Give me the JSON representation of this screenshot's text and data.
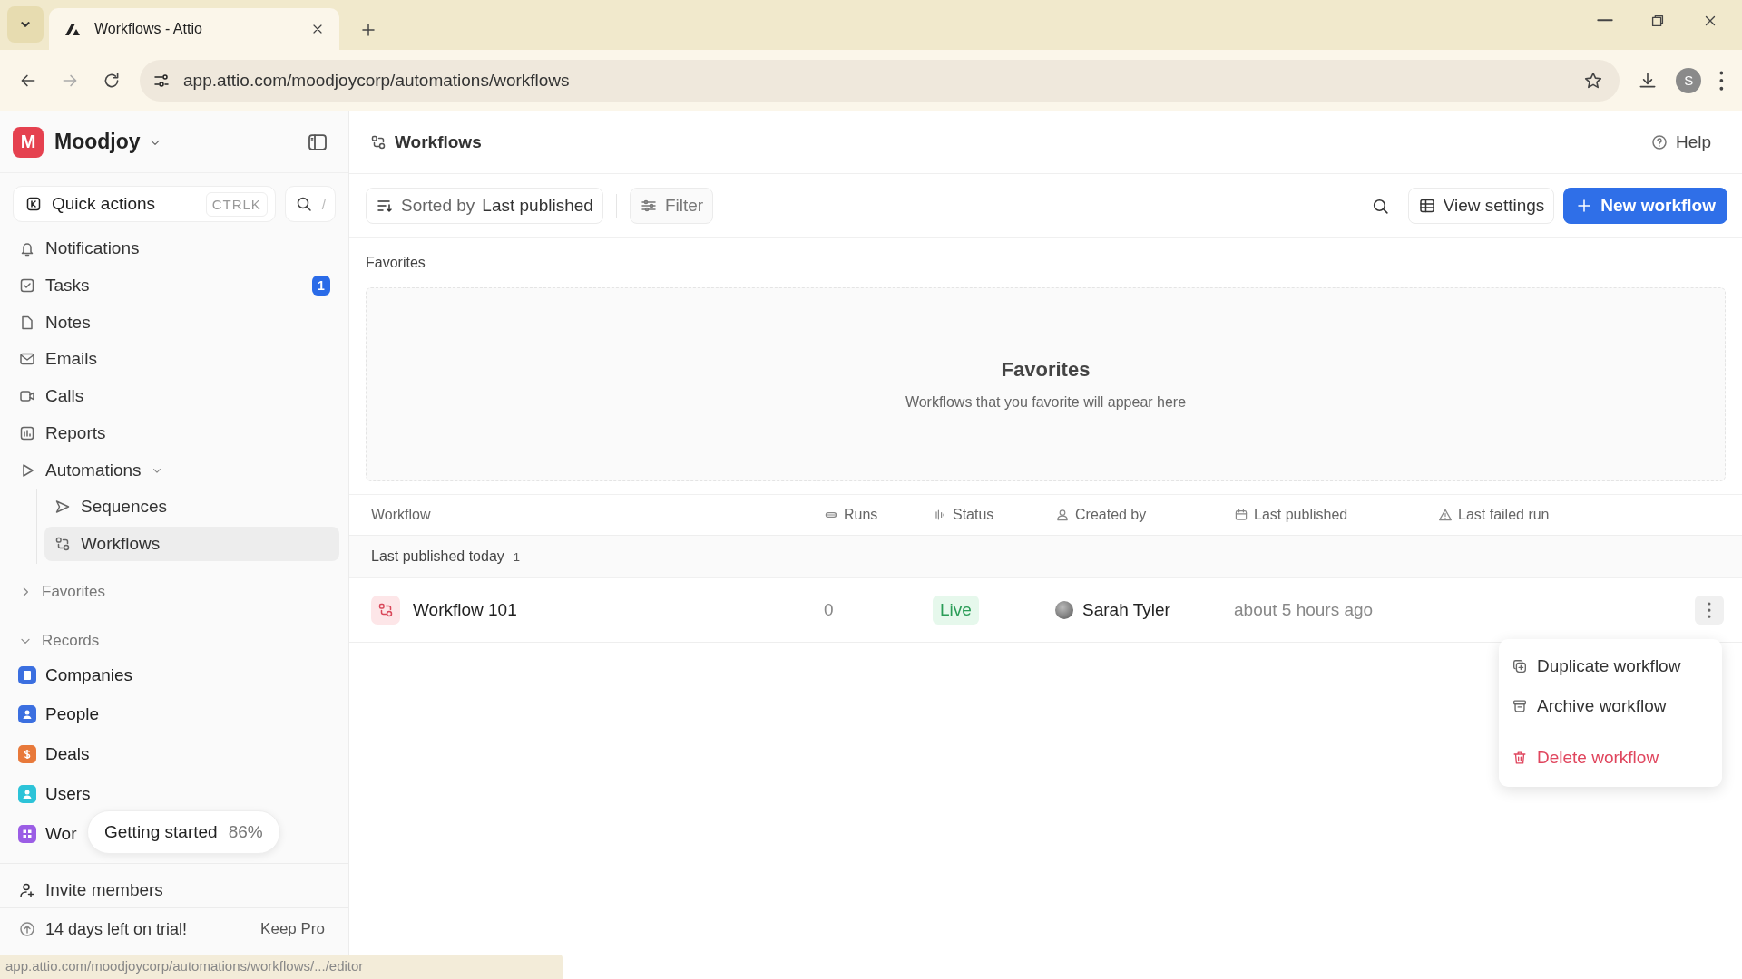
{
  "browser": {
    "tab_title": "Workflows - Attio",
    "url": "app.attio.com/moodjoycorp/automations/workflows",
    "profile_initial": "S",
    "status_url": "app.attio.com/moodjoycorp/automations/workflows/.../editor"
  },
  "sidebar": {
    "workspace": {
      "initial": "M",
      "name": "Moodjoy"
    },
    "quick_actions": {
      "label": "Quick actions",
      "shortcut": "CTRLK",
      "search_shortcut": "/"
    },
    "nav": [
      {
        "kind": "bell",
        "label": "Notifications",
        "selected": false
      },
      {
        "kind": "task",
        "label": "Tasks",
        "badge": "1",
        "selected": false
      },
      {
        "kind": "note",
        "label": "Notes",
        "selected": false
      },
      {
        "kind": "mail",
        "label": "Emails",
        "selected": false
      },
      {
        "kind": "call",
        "label": "Calls",
        "selected": false
      },
      {
        "kind": "report",
        "label": "Reports",
        "selected": false
      },
      {
        "kind": "automation",
        "label": "Automations",
        "selected": false,
        "expanded": true,
        "children": [
          {
            "kind": "sequence",
            "label": "Sequences",
            "selected": false
          },
          {
            "kind": "workflow",
            "label": "Workflows",
            "selected": true
          }
        ]
      }
    ],
    "favorites": {
      "label": "Favorites",
      "expanded": false
    },
    "records": {
      "label": "Records",
      "expanded": true,
      "items": [
        {
          "kind": "company",
          "label": "Companies",
          "color": "#3b6fe0"
        },
        {
          "kind": "person",
          "label": "People",
          "color": "#3b6fe0"
        },
        {
          "kind": "deal",
          "label": "Deals",
          "color": "#e8793a"
        },
        {
          "kind": "person",
          "label": "Users",
          "color": "#2cc3d8"
        },
        {
          "kind": "grid",
          "label": "Wor",
          "color": "#9b5de5"
        }
      ]
    },
    "getting_started": {
      "label": "Getting started",
      "percent": "86%"
    },
    "invite": "Invite members",
    "trial": {
      "text": "14 days left on trial!",
      "action": "Keep Pro"
    }
  },
  "main": {
    "title": "Workflows",
    "help": "Help",
    "toolbar": {
      "sort_prefix": "Sorted by",
      "sort_value": "Last published",
      "filter": "Filter",
      "view_settings": "View settings",
      "new_button": "New workflow"
    },
    "favorites": {
      "section_label": "Favorites",
      "title": "Favorites",
      "subtitle": "Workflows that you favorite will appear here"
    },
    "table": {
      "columns": [
        {
          "kind": "none",
          "label": "Workflow"
        },
        {
          "kind": "runs",
          "label": "Runs"
        },
        {
          "kind": "status",
          "label": "Status"
        },
        {
          "kind": "person",
          "label": "Created by"
        },
        {
          "kind": "calendar",
          "label": "Last published"
        },
        {
          "kind": "warning",
          "label": "Last failed run"
        }
      ],
      "groups": [
        {
          "label": "Last published today",
          "count": "1",
          "rows": [
            {
              "name": "Workflow 101",
              "runs": "0",
              "status": "Live",
              "created_by": "Sarah Tyler",
              "last_published": "about 5 hours ago"
            }
          ]
        }
      ]
    },
    "menu": [
      {
        "kind": "duplicate",
        "label": "Duplicate workflow",
        "danger": false
      },
      {
        "kind": "archive",
        "label": "Archive workflow",
        "danger": false
      },
      {
        "kind": "delete",
        "label": "Delete workflow",
        "danger": true
      }
    ]
  }
}
